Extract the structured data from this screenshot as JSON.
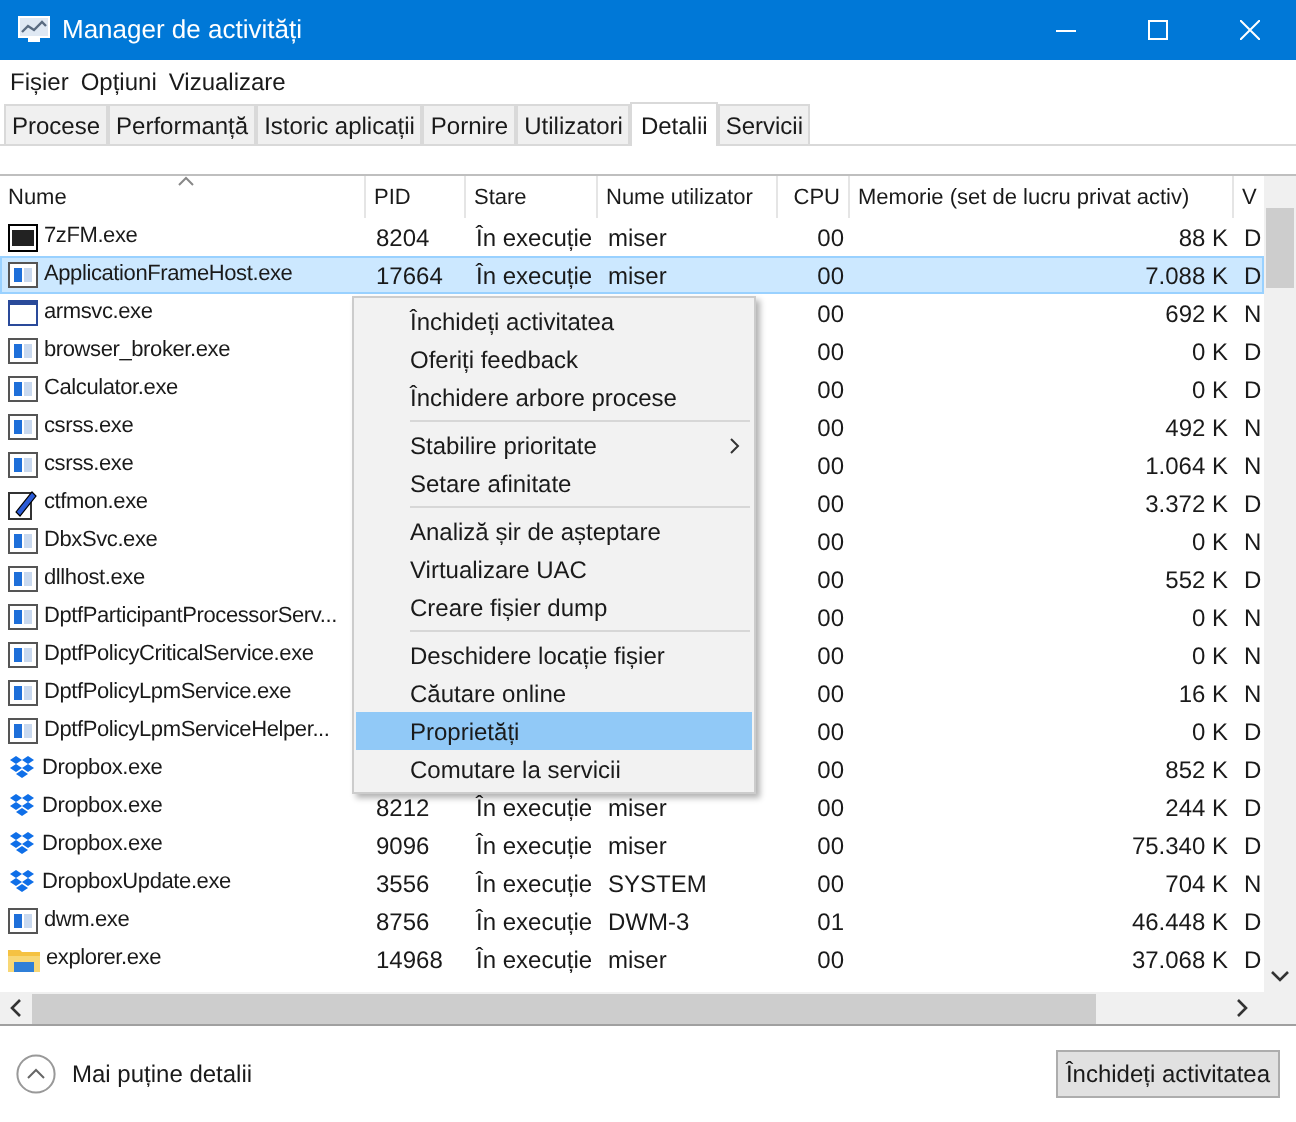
{
  "window": {
    "title": "Manager de activități"
  },
  "menu_bar": [
    "Fișier",
    "Opțiuni",
    "Vizualizare"
  ],
  "tabs": [
    {
      "label": "Procese",
      "selected": false
    },
    {
      "label": "Performanță",
      "selected": false
    },
    {
      "label": "Istoric aplicații",
      "selected": false
    },
    {
      "label": "Pornire",
      "selected": false
    },
    {
      "label": "Utilizatori",
      "selected": false
    },
    {
      "label": "Detalii",
      "selected": true
    },
    {
      "label": "Servicii",
      "selected": false
    }
  ],
  "table": {
    "columns": [
      "Nume",
      "PID",
      "Stare",
      "Nume utilizator",
      "CPU",
      "Memorie (set de lucru privat activ)",
      "V"
    ],
    "rows": [
      {
        "kind": "archive",
        "name": "7zFM.exe",
        "pid": "8204",
        "status": "În execuție",
        "user": "miser",
        "cpu": "00",
        "memory": "88 K",
        "column_7": "D",
        "selected": false
      },
      {
        "kind": "app",
        "name": "ApplicationFrameHost.exe",
        "pid": "17664",
        "status": "În execuție",
        "user": "miser",
        "cpu": "00",
        "memory": "7.088 K",
        "column_7": "D",
        "selected": true
      },
      {
        "kind": "window",
        "name": "armsvc.exe",
        "cpu": "00",
        "memory": "692 K",
        "column_7": "N",
        "selected": false
      },
      {
        "kind": "app",
        "name": "browser_broker.exe",
        "cpu": "00",
        "memory": "0 K",
        "column_7": "D",
        "selected": false
      },
      {
        "kind": "app",
        "name": "Calculator.exe",
        "cpu": "00",
        "memory": "0 K",
        "column_7": "D",
        "selected": false
      },
      {
        "kind": "app",
        "name": "csrss.exe",
        "cpu": "00",
        "memory": "492 K",
        "column_7": "N",
        "selected": false
      },
      {
        "kind": "app",
        "name": "csrss.exe",
        "cpu": "00",
        "memory": "1.064 K",
        "column_7": "N",
        "selected": false
      },
      {
        "kind": "pen",
        "name": "ctfmon.exe",
        "cpu": "00",
        "memory": "3.372 K",
        "column_7": "D",
        "selected": false
      },
      {
        "kind": "app",
        "name": "DbxSvc.exe",
        "cpu": "00",
        "memory": "0 K",
        "column_7": "N",
        "selected": false
      },
      {
        "kind": "app",
        "name": "dllhost.exe",
        "cpu": "00",
        "memory": "552 K",
        "column_7": "D",
        "selected": false
      },
      {
        "kind": "app",
        "name": "DptfParticipantProcessorServ...",
        "cpu": "00",
        "memory": "0 K",
        "column_7": "N",
        "selected": false
      },
      {
        "kind": "app",
        "name": "DptfPolicyCriticalService.exe",
        "cpu": "00",
        "memory": "0 K",
        "column_7": "N",
        "selected": false
      },
      {
        "kind": "app",
        "name": "DptfPolicyLpmService.exe",
        "cpu": "00",
        "memory": "16 K",
        "column_7": "N",
        "selected": false
      },
      {
        "kind": "app",
        "name": "DptfPolicyLpmServiceHelper...",
        "cpu": "00",
        "memory": "0 K",
        "column_7": "D",
        "selected": false
      },
      {
        "kind": "dropbox",
        "name": "Dropbox.exe",
        "cpu": "00",
        "memory": "852 K",
        "column_7": "D",
        "selected": false
      },
      {
        "kind": "dropbox",
        "name": "Dropbox.exe",
        "pid": "8212",
        "status": "În execuție",
        "user": "miser",
        "cpu": "00",
        "memory": "244 K",
        "column_7": "D",
        "selected": false
      },
      {
        "kind": "dropbox",
        "name": "Dropbox.exe",
        "pid": "9096",
        "status": "În execuție",
        "user": "miser",
        "cpu": "00",
        "memory": "75.340 K",
        "column_7": "D",
        "selected": false
      },
      {
        "kind": "dropbox",
        "name": "DropboxUpdate.exe",
        "pid": "3556",
        "status": "În execuție",
        "user": "SYSTEM",
        "cpu": "00",
        "memory": "704 K",
        "column_7": "N",
        "selected": false
      },
      {
        "kind": "app",
        "name": "dwm.exe",
        "pid": "8756",
        "status": "În execuție",
        "user": "DWM-3",
        "cpu": "01",
        "memory": "46.448 K",
        "column_7": "D",
        "selected": false
      },
      {
        "kind": "folder",
        "name": "explorer.exe",
        "pid": "14968",
        "status": "În execuție",
        "user": "miser",
        "cpu": "00",
        "memory": "37.068 K",
        "column_7": "D",
        "selected": false
      }
    ]
  },
  "context_menu": [
    {
      "kind": "item",
      "label": "Închideți activitatea",
      "selected": false
    },
    {
      "kind": "item",
      "label": "Oferiți feedback",
      "selected": false
    },
    {
      "kind": "item",
      "label": "Închidere arbore procese",
      "selected": false
    },
    {
      "kind": "separator"
    },
    {
      "kind": "submenu",
      "label": "Stabilire prioritate",
      "selected": false
    },
    {
      "kind": "item",
      "label": "Setare afinitate",
      "selected": false
    },
    {
      "kind": "separator"
    },
    {
      "kind": "item",
      "label": "Analiză șir de așteptare",
      "selected": false
    },
    {
      "kind": "item",
      "label": "Virtualizare UAC",
      "selected": false
    },
    {
      "kind": "item",
      "label": "Creare fișier dump",
      "selected": false
    },
    {
      "kind": "separator"
    },
    {
      "kind": "item",
      "label": "Deschidere locație fișier",
      "selected": false
    },
    {
      "kind": "item",
      "label": "Căutare online",
      "selected": false
    },
    {
      "kind": "item",
      "label": "Proprietăți",
      "selected": true
    },
    {
      "kind": "item",
      "label": "Comutare la servicii",
      "selected": false
    }
  ],
  "footer": {
    "details_toggle": "Mai puține detalii",
    "end_task_button": "Închideți activitatea"
  }
}
